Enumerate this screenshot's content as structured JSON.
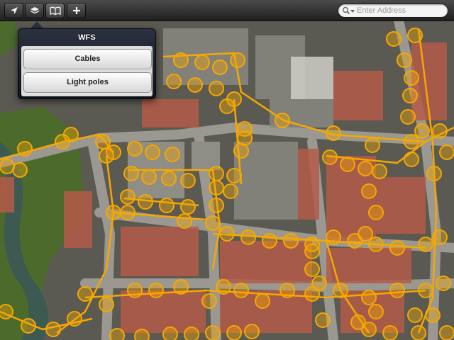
{
  "toolbar": {
    "buttons": [
      {
        "name": "locate-button",
        "icon": "location-arrow-icon"
      },
      {
        "name": "layers-button",
        "icon": "layers-icon"
      },
      {
        "name": "bookmarks-button",
        "icon": "open-book-icon",
        "active": true
      },
      {
        "name": "add-button",
        "icon": "plus-icon"
      }
    ],
    "search": {
      "placeholder": "Enter Address",
      "value": "",
      "icon": "search-icon"
    }
  },
  "popover": {
    "title": "WFS",
    "items": [
      {
        "label": "Cables"
      },
      {
        "label": "Light poles"
      }
    ]
  },
  "map": {
    "type": "aerial-imagery",
    "overlays": [
      "cable-lines",
      "light-pole-markers"
    ],
    "colors": {
      "cable_line": "#f5a800",
      "light_pole_fill": "#f5a80066",
      "light_pole_stroke": "#f5a800",
      "roof_red": "#b45a48",
      "roof_grey": "#8a8880",
      "grass": "#4c6a2c",
      "water": "#3d5a52",
      "road": "#9a9890"
    }
  }
}
